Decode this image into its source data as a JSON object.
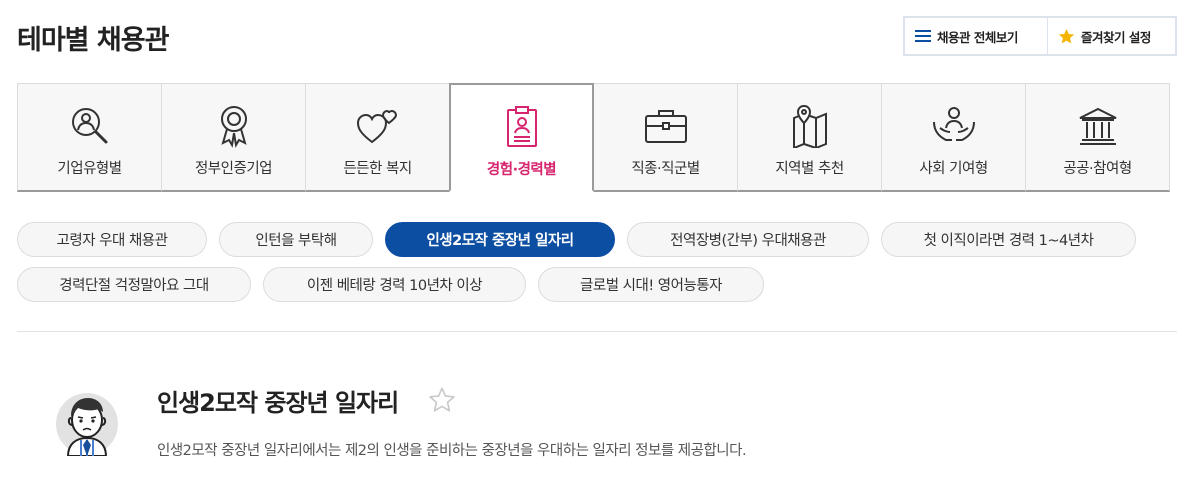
{
  "page_title": "테마별 채용관",
  "top_buttons": {
    "view_all": "채용관 전체보기",
    "favorites": "즐겨찾기 설정"
  },
  "tabs": [
    {
      "label": "기업유형별",
      "icon": "search-person-icon"
    },
    {
      "label": "정부인증기업",
      "icon": "award-ribbon-icon"
    },
    {
      "label": "든든한 복지",
      "icon": "hearts-icon"
    },
    {
      "label": "경험·경력별",
      "icon": "resume-clipboard-icon",
      "active": true
    },
    {
      "label": "직종·직군별",
      "icon": "briefcase-icon"
    },
    {
      "label": "지역별 추천",
      "icon": "map-pin-icon"
    },
    {
      "label": "사회 기여형",
      "icon": "hands-people-icon"
    },
    {
      "label": "공공·참여형",
      "icon": "government-building-icon"
    }
  ],
  "chips": [
    {
      "label": "고령자 우대 채용관"
    },
    {
      "label": "인턴을 부탁해"
    },
    {
      "label": "인생2모작 중장년 일자리",
      "active": true
    },
    {
      "label": "전역장병(간부) 우대채용관"
    },
    {
      "label": "첫 이직이라면 경력 1~4년차"
    },
    {
      "label": "경력단절 걱정말아요 그대"
    },
    {
      "label": "이젠 베테랑 경력 10년차 이상"
    },
    {
      "label": "글로벌 시대! 영어능통자"
    }
  ],
  "section": {
    "title": "인생2모작 중장년 일자리",
    "description": "인생2모작 중장년 일자리에서는 제2의 인생을 준비하는 중장년을 우대하는 일자리 정보를 제공합니다."
  },
  "colors": {
    "active_tab_text": "#d6246e",
    "active_chip_bg": "#0c4ea2",
    "star_accent": "#f5b400"
  }
}
